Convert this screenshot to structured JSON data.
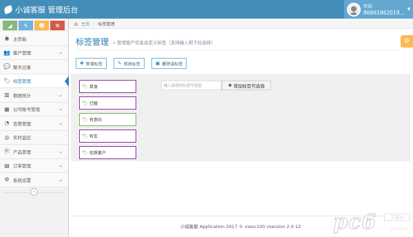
{
  "app": {
    "title": "小诚客服 管理后台"
  },
  "user": {
    "welcome": "欢迎,",
    "id": "86861862019..."
  },
  "sidebar": {
    "items": [
      {
        "label": "主页板",
        "icon": "dashboard-icon",
        "glyph": "◉",
        "has_arrow": false
      },
      {
        "label": "客户管理",
        "icon": "users-icon",
        "glyph": "👥",
        "has_arrow": true
      },
      {
        "label": "聊天记录",
        "icon": "chat-icon",
        "glyph": "💬",
        "has_arrow": false
      },
      {
        "label": "标签管理",
        "icon": "tag-icon",
        "glyph": "🏷",
        "has_arrow": false,
        "active": true
      },
      {
        "label": "数据统计",
        "icon": "bar-chart-icon",
        "glyph": "▥",
        "has_arrow": true
      },
      {
        "label": "公司账号管理",
        "icon": "building-icon",
        "glyph": "▦",
        "has_arrow": true
      },
      {
        "label": "告警管理",
        "icon": "alarm-icon",
        "glyph": "◔",
        "has_arrow": true
      },
      {
        "label": "实时监控",
        "icon": "eye-icon",
        "glyph": "◎",
        "has_arrow": false
      },
      {
        "label": "产品管理",
        "icon": "product-icon",
        "glyph": "Ⓟ",
        "has_arrow": true
      },
      {
        "label": "订单管理",
        "icon": "order-icon",
        "glyph": "▤",
        "has_arrow": true
      },
      {
        "label": "系统设置",
        "icon": "gear-icon",
        "glyph": "⚙",
        "has_arrow": true
      }
    ]
  },
  "breadcrumb": {
    "home": "主页",
    "current": "标签管理"
  },
  "page": {
    "title": "标签管理",
    "subtitle": "» 管理客户信息自定义标签（支持输入和下拉选择）"
  },
  "toolbar": {
    "new_label": "新增标签",
    "edit_label": "修改标签",
    "delete_label": "删除该标签"
  },
  "tags": [
    {
      "label": "单身",
      "style": "purple"
    },
    {
      "label": "已婚",
      "style": "purple"
    },
    {
      "label": "有意向",
      "style": "green"
    },
    {
      "label": "有车",
      "style": "purple"
    },
    {
      "label": "优质客户",
      "style": "purple"
    }
  ],
  "tag_input": {
    "placeholder": "输入新增的标签可选值"
  },
  "add_option": {
    "label": "增加标签可选值"
  },
  "footer": {
    "text": "小诚客服 Application 2017 © xiaoc100 vsersion 2.0.12"
  },
  "watermark": {
    "text": "pc6",
    "box": "下载站",
    "url": "pc6.com"
  },
  "colors": {
    "topbar": "#438eb9",
    "accent": "#2679b5",
    "tag_purple": "#8b2d9c",
    "tag_green": "#6cb35a"
  }
}
